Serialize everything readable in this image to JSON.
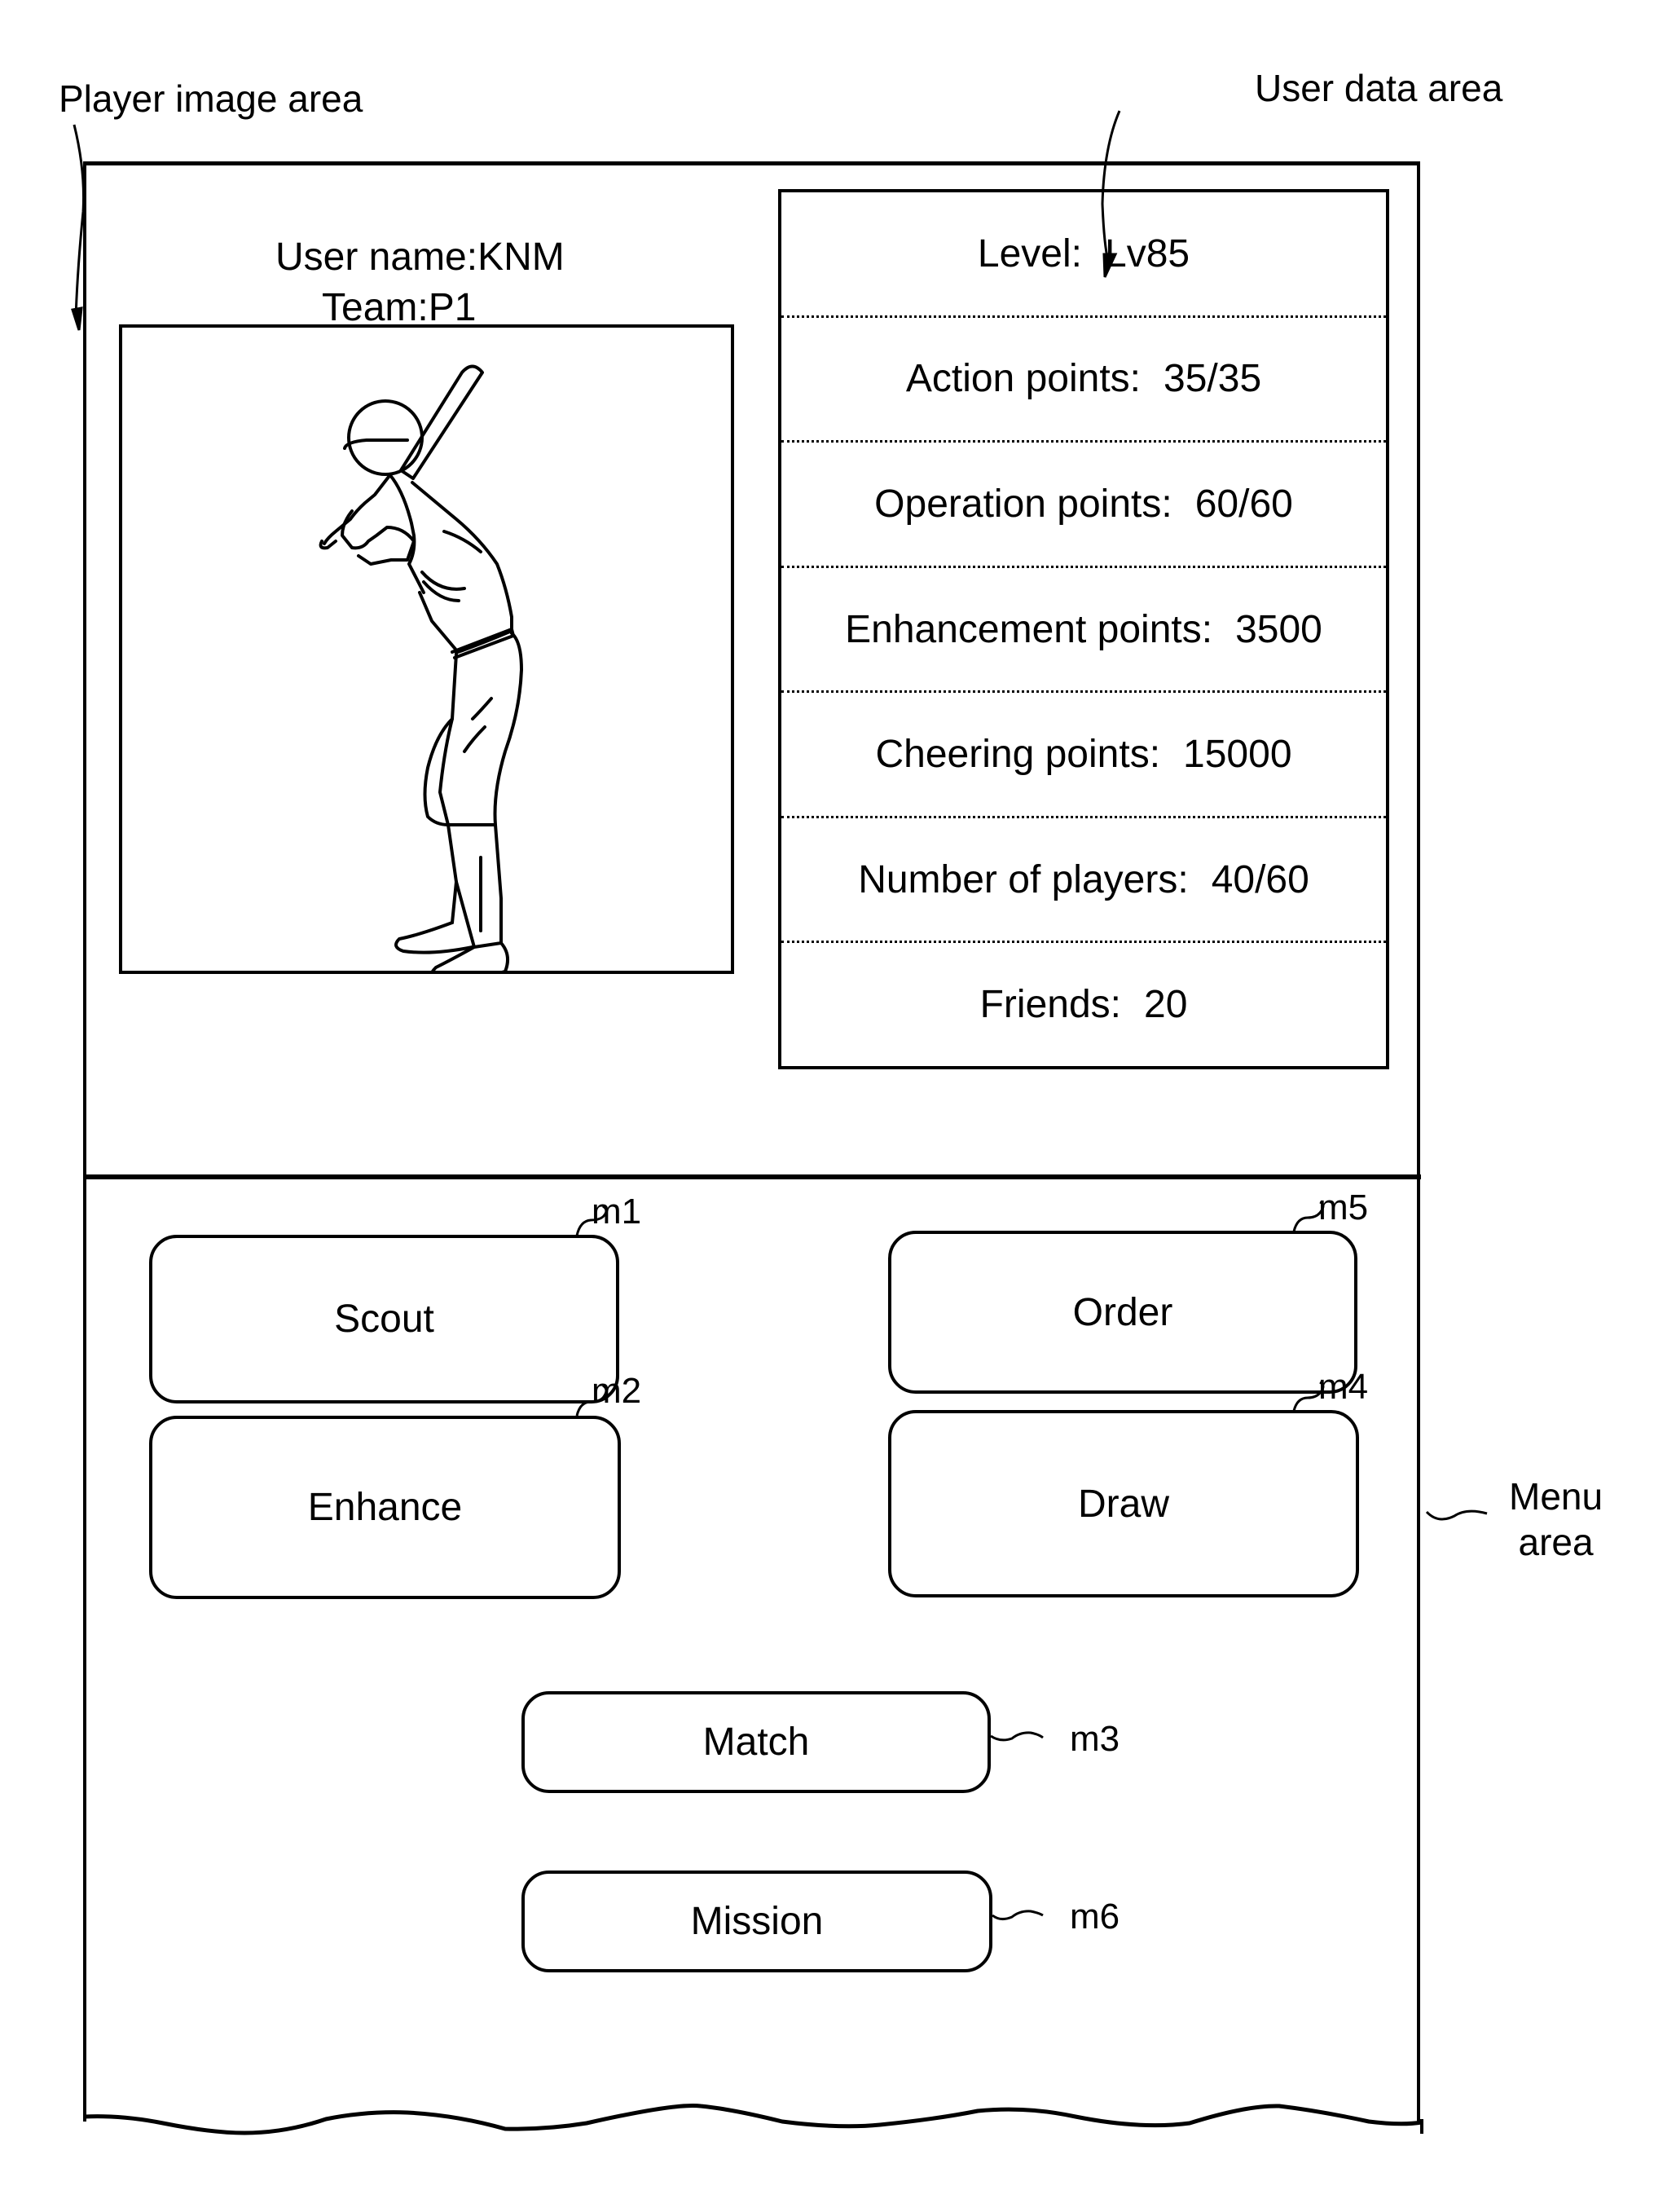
{
  "callouts": {
    "player_image_area": "Player image area",
    "user_data_area": "User data area",
    "menu_area_line1": "Menu",
    "menu_area_line2": "area"
  },
  "user": {
    "name_label": "User name",
    "name_value": "KNM",
    "team_label": "Team",
    "team_value": "P1",
    "separator": ":"
  },
  "player_image": {
    "icon": "baseball-batter-illustration"
  },
  "user_data": {
    "rows": [
      {
        "label": "Level:",
        "value": "Lv85"
      },
      {
        "label": "Action points:",
        "value": "35/35"
      },
      {
        "label": "Operation points:",
        "value": "60/60"
      },
      {
        "label": "Enhancement points:",
        "value": "3500"
      },
      {
        "label": "Cheering points:",
        "value": "15000"
      },
      {
        "label": "Number of players:",
        "value": "40/60"
      },
      {
        "label": "Friends:",
        "value": "20"
      }
    ]
  },
  "menu": {
    "buttons": [
      {
        "id": "m1",
        "label": "Scout"
      },
      {
        "id": "m2",
        "label": "Enhance"
      },
      {
        "id": "m3",
        "label": "Match"
      },
      {
        "id": "m4",
        "label": "Draw"
      },
      {
        "id": "m5",
        "label": "Order"
      },
      {
        "id": "m6",
        "label": "Mission"
      }
    ]
  }
}
